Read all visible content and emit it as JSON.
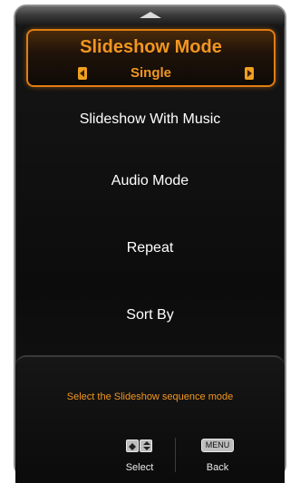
{
  "menu": {
    "selected_title": "Slideshow Mode",
    "selected_value": "Single",
    "items": [
      {
        "label": "Slideshow With Music"
      },
      {
        "label": "Audio Mode"
      },
      {
        "label": "Repeat"
      },
      {
        "label": "Sort By"
      }
    ]
  },
  "help": {
    "text": "Select the Slideshow sequence mode"
  },
  "controls": {
    "select_label": "Select",
    "menu_key_label": "MENU",
    "back_label": "Back"
  },
  "colors": {
    "accent": "#f29620",
    "highlight_border": "#e07d12",
    "text": "#ffffff",
    "background": "#0c0c0c"
  },
  "icons": {
    "scroll_up": "chevron-up-icon",
    "value_prev": "arrow-left-icon",
    "value_next": "arrow-right-icon",
    "left_right_key": "left-right-key-icon",
    "up_down_key": "up-down-key-icon"
  }
}
